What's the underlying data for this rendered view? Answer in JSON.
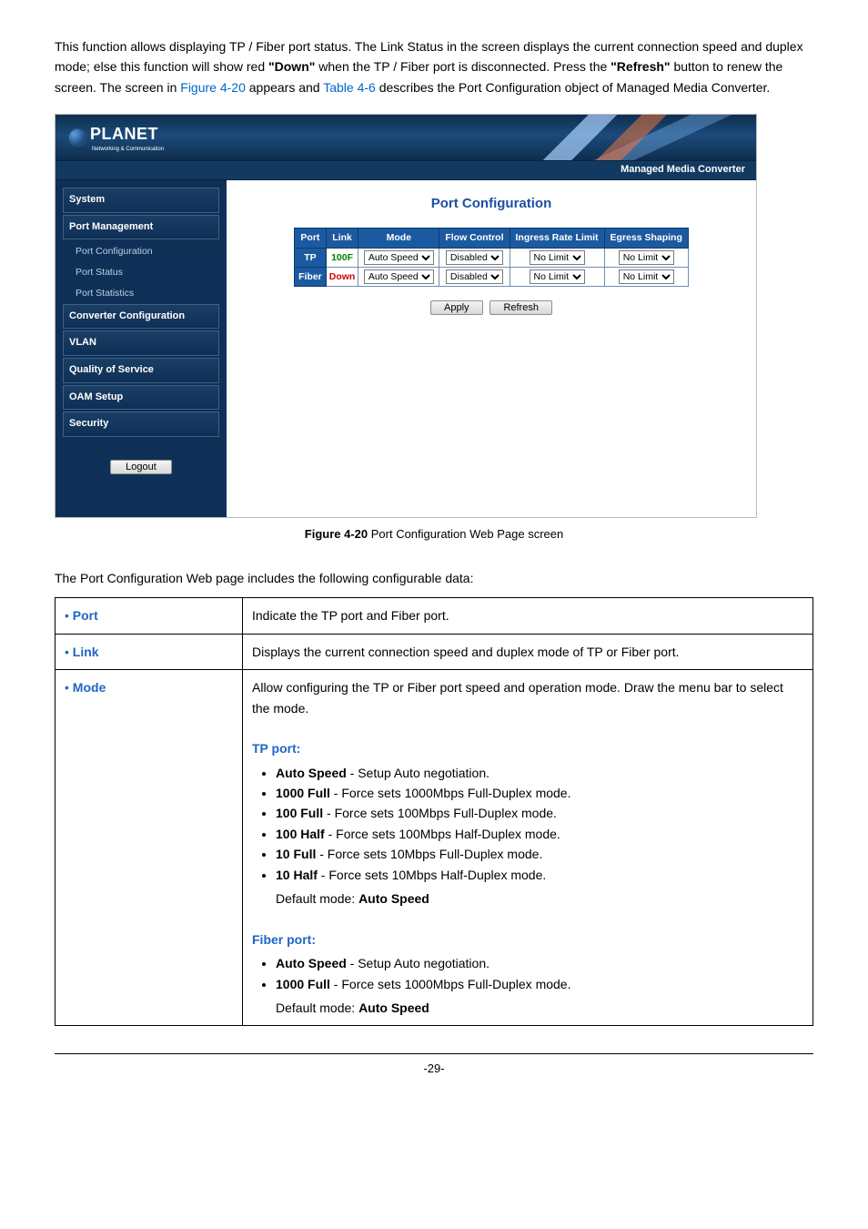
{
  "intro": {
    "p1a": "This function allows displaying TP / Fiber port status. The Link Status in the screen displays the current connection speed and duplex mode; else this function will show red ",
    "down_word": "\"Down\"",
    "p1b": " when the TP / Fiber port is disconnected. Press the ",
    "refresh_word": "\"Refresh\"",
    "p1c": " button to renew the screen. The screen in ",
    "figref": "Figure 4-20",
    "p1d": " appears and ",
    "tableref": "Table 4-6",
    "p1e": " describes the Port Configuration object of Managed Media Converter."
  },
  "ui": {
    "logo_text": "PLANET",
    "logo_sub": "Networking & Communication",
    "subbar": "Managed Media Converter",
    "sidebar": {
      "system": "System",
      "port_mgmt": "Port Management",
      "sub_port_config": "Port Configuration",
      "sub_port_status": "Port Status",
      "sub_port_stats": "Port Statistics",
      "conv_config": "Converter Configuration",
      "vlan": "VLAN",
      "qos": "Quality of Service",
      "oam": "OAM Setup",
      "security": "Security",
      "logout": "Logout"
    },
    "title": "Port Configuration",
    "th": {
      "port": "Port",
      "link": "Link",
      "mode": "Mode",
      "flow": "Flow Control",
      "ingress": "Ingress Rate Limit",
      "egress": "Egress Shaping"
    },
    "rows": [
      {
        "port": "TP",
        "link": "100F",
        "linkClass": "linkup",
        "mode": "Auto Speed",
        "flow": "Disabled",
        "ingress": "No Limit",
        "egress": "No Limit"
      },
      {
        "port": "Fiber",
        "link": "Down",
        "linkClass": "linkdown",
        "mode": "Auto Speed",
        "flow": "Disabled",
        "ingress": "No Limit",
        "egress": "No Limit"
      }
    ],
    "buttons": {
      "apply": "Apply",
      "refresh": "Refresh"
    }
  },
  "figcap": {
    "prefix": "Figure 4-20 ",
    "text": "Port Configuration Web Page screen"
  },
  "desc_intro": "The Port Configuration Web page includes the following configurable data:",
  "table": {
    "r1": {
      "obj": "Port",
      "desc": "Indicate the TP port and Fiber port."
    },
    "r2": {
      "obj": "Link",
      "desc": "Displays the current connection speed and duplex mode of TP or Fiber port."
    },
    "r3": {
      "obj": "Mode",
      "lead": "Allow configuring the TP or Fiber port speed and operation mode. Draw the menu bar to select the mode.",
      "tp_label": "TP port:",
      "tp_items": [
        {
          "b": "Auto Speed",
          "t": " - Setup Auto negotiation."
        },
        {
          "b": "1000 Full",
          "t": " - Force sets 1000Mbps Full-Duplex mode."
        },
        {
          "b": "100 Full",
          "t": " - Force sets 100Mbps Full-Duplex mode."
        },
        {
          "b": "100 Half",
          "t": " - Force sets 100Mbps Half-Duplex mode."
        },
        {
          "b": "10 Full",
          "t": " - Force sets 10Mbps Full-Duplex mode."
        },
        {
          "b": "10 Half",
          "t": " - Force sets 10Mbps Half-Duplex mode."
        }
      ],
      "tp_default_a": "Default mode: ",
      "tp_default_b": "Auto Speed",
      "fiber_label": "Fiber port:",
      "fiber_items": [
        {
          "b": "Auto Speed",
          "t": " - Setup Auto negotiation."
        },
        {
          "b": "1000 Full",
          "t": " - Force sets 1000Mbps Full-Duplex mode."
        }
      ],
      "fiber_default_a": "Default mode: ",
      "fiber_default_b": "Auto Speed"
    }
  },
  "pagenum": "-29-"
}
